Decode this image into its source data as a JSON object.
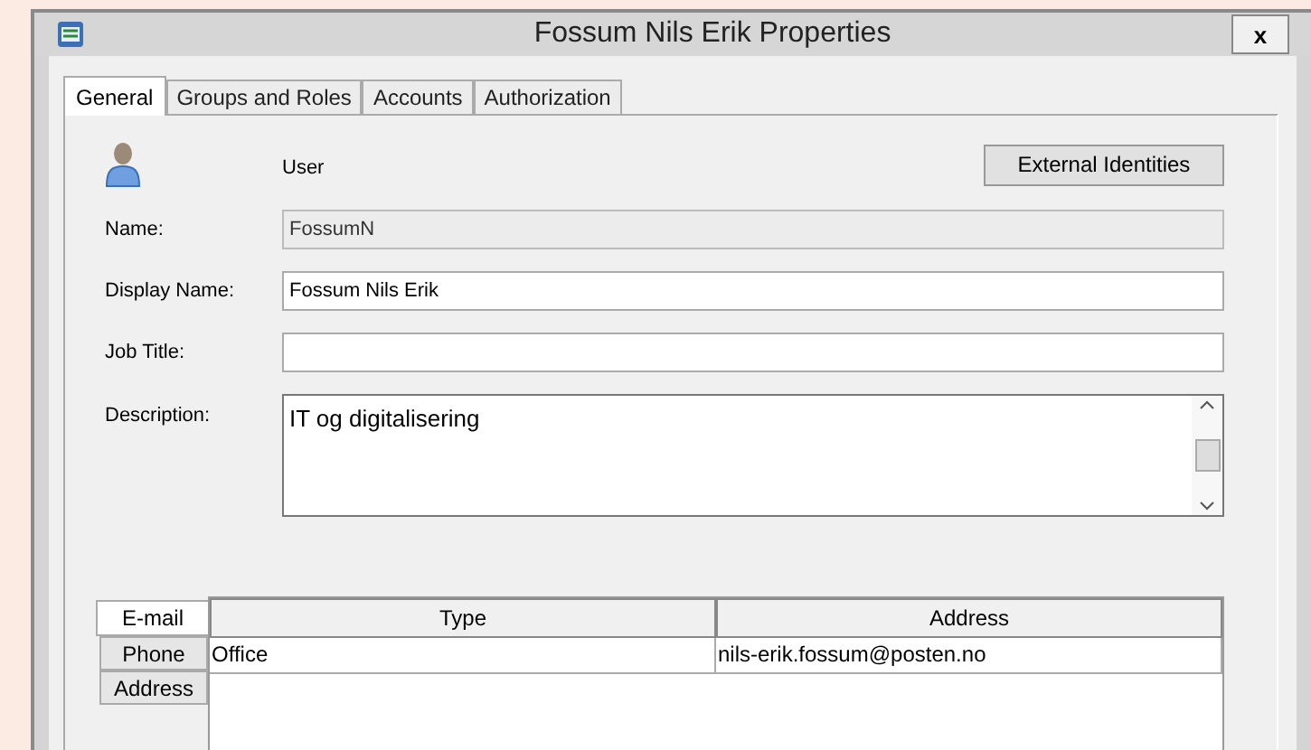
{
  "window": {
    "title": "Fossum Nils Erik Properties",
    "close": "x"
  },
  "tabs": [
    {
      "label": "General",
      "selected": true
    },
    {
      "label": "Groups and Roles",
      "selected": false
    },
    {
      "label": "Accounts",
      "selected": false
    },
    {
      "label": "Authorization",
      "selected": false
    }
  ],
  "object_type": "User",
  "external_identities_button": "External Identities",
  "fields": [
    {
      "label": "Name:",
      "value": "FossumN",
      "disabled": true
    },
    {
      "label": "Display Name:",
      "value": "Fossum Nils Erik",
      "disabled": false
    },
    {
      "label": "Job Title:",
      "disabled": false
    }
  ],
  "description": {
    "label": "Description:",
    "value": "IT og digitalisering"
  },
  "contact_tabs": [
    {
      "label": "E-mail",
      "selected": true
    },
    {
      "label": "Phone",
      "selected": false
    },
    {
      "label": "Address",
      "selected": false
    }
  ],
  "table": {
    "columns": [
      "Type",
      "Address"
    ],
    "rows": [
      [
        "Office",
        "nils-erik.fossum@posten.no"
      ]
    ]
  }
}
